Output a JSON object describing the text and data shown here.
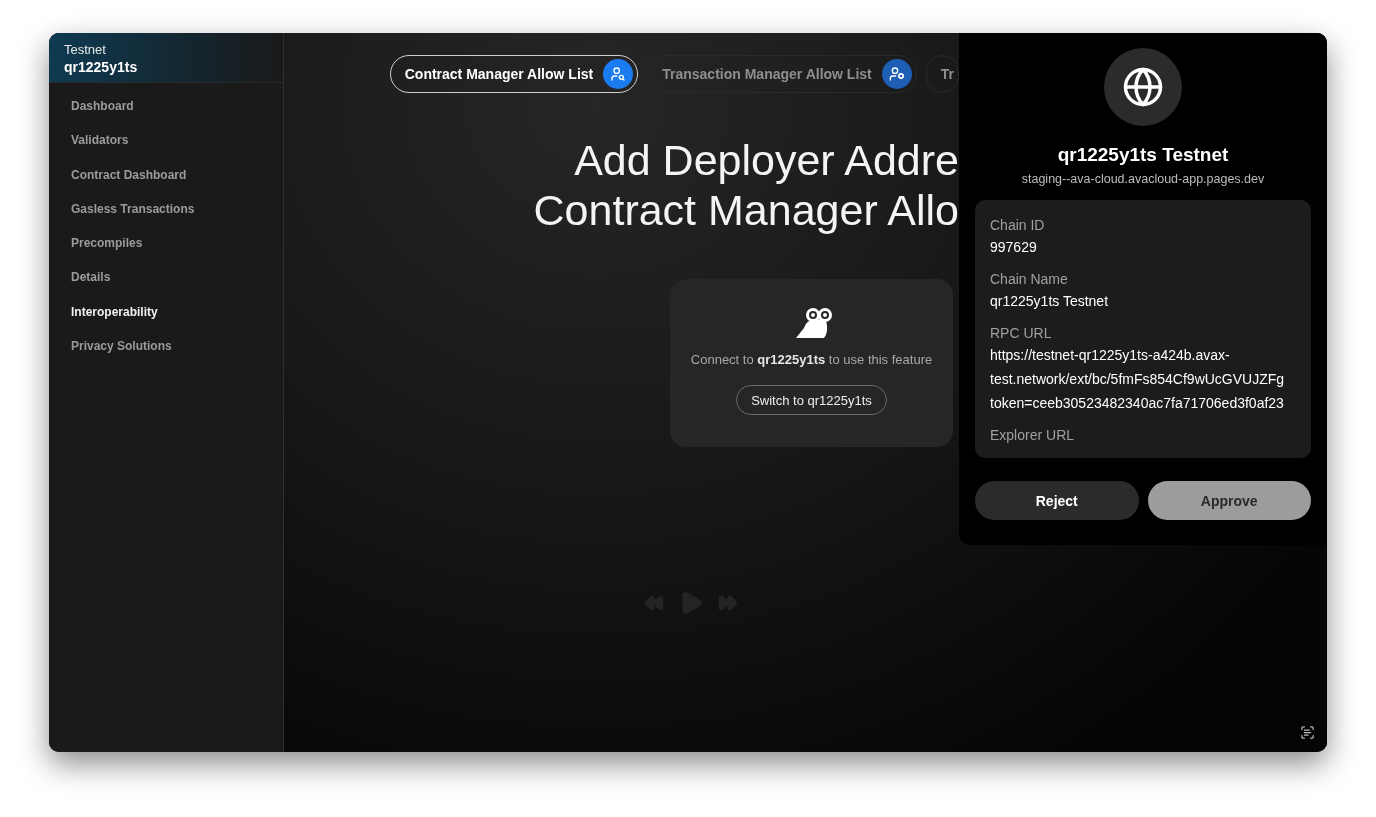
{
  "sidebar": {
    "network": "Testnet",
    "chain": "qr1225y1ts",
    "items": [
      {
        "label": "Dashboard",
        "selected": false
      },
      {
        "label": "Validators",
        "selected": false
      },
      {
        "label": "Contract Dashboard",
        "selected": false
      },
      {
        "label": "Gasless Transactions",
        "selected": false
      },
      {
        "label": "Precompiles",
        "selected": false
      },
      {
        "label": "Details",
        "selected": false
      },
      {
        "label": "Interoperability",
        "selected": true
      },
      {
        "label": "Privacy Solutions",
        "selected": false
      }
    ]
  },
  "tabs": [
    {
      "label": "Contract Manager Allow List",
      "selected": true
    },
    {
      "label": "Transaction Manager Allow List",
      "selected": false
    },
    {
      "label": "Tr",
      "selected": false
    }
  ],
  "heading": {
    "lines": [
      "Add Deployer Addre",
      "Contract Manager Allo"
    ]
  },
  "connect_card": {
    "message": "Connect to **qr1225y1ts** to use this feature",
    "button": "Switch to qr1225y1ts"
  },
  "popup": {
    "title": "qr1225y1ts Testnet",
    "origin": "staging--ava-cloud.avacloud-app.pages.dev",
    "fields": [
      {
        "label": "Chain ID",
        "value_lines": [
          "997629"
        ]
      },
      {
        "label": "Chain Name",
        "value_lines": [
          "qr1225y1ts Testnet"
        ]
      },
      {
        "label": "RPC URL",
        "value_lines": [
          "https://testnet-qr1225y1ts-a424b.avax-",
          "test.network/ext/bc/5fmFs854Cf9wUcGVUJZFg",
          "token=ceeb30523482340ac7fa71706ed3f0af23"
        ]
      },
      {
        "label": "Explorer URL"
      }
    ],
    "buttons": [
      {
        "label": "Reject",
        "kind": "secondary"
      },
      {
        "label": "Approve",
        "kind": "primary"
      }
    ]
  }
}
